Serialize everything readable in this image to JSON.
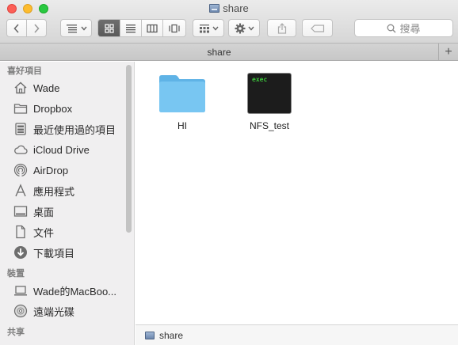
{
  "window": {
    "title": "share",
    "title_icon": "network-drive-icon"
  },
  "toolbar": {
    "back_icon": "chevron-left-icon",
    "forward_icon": "chevron-right-icon",
    "view_modes": [
      "icon",
      "list",
      "column",
      "cover-flow"
    ],
    "active_view": "icon",
    "search_placeholder": "搜尋"
  },
  "tab": {
    "label": "share",
    "add_symbol": "+"
  },
  "sidebar": {
    "sections": [
      {
        "title": "喜好項目",
        "items": [
          {
            "label": "Wade",
            "icon": "home-icon"
          },
          {
            "label": "Dropbox",
            "icon": "folder-icon"
          },
          {
            "label": "最近使用過的項目",
            "icon": "recents-icon"
          },
          {
            "label": "iCloud Drive",
            "icon": "cloud-icon"
          },
          {
            "label": "AirDrop",
            "icon": "airdrop-icon"
          },
          {
            "label": "應用程式",
            "icon": "applications-icon"
          },
          {
            "label": "桌面",
            "icon": "desktop-icon"
          },
          {
            "label": "文件",
            "icon": "document-icon"
          },
          {
            "label": "下載項目",
            "icon": "download-icon"
          }
        ]
      },
      {
        "title": "裝置",
        "items": [
          {
            "label": "Wade的MacBoo...",
            "icon": "laptop-icon"
          },
          {
            "label": "遠端光碟",
            "icon": "disc-icon"
          }
        ]
      },
      {
        "title": "共享",
        "items": []
      }
    ]
  },
  "files": [
    {
      "name": "HI",
      "kind": "folder",
      "icon": "folder-icon"
    },
    {
      "name": "NFS_test",
      "kind": "executable",
      "icon": "terminal-exec-icon",
      "badge": "exec"
    }
  ],
  "pathbar": {
    "label": "share",
    "icon": "network-drive-icon"
  },
  "colors": {
    "folder": "#6cc0ee",
    "exec_text": "#3ac23a",
    "exec_bg": "#1c1c1c"
  }
}
